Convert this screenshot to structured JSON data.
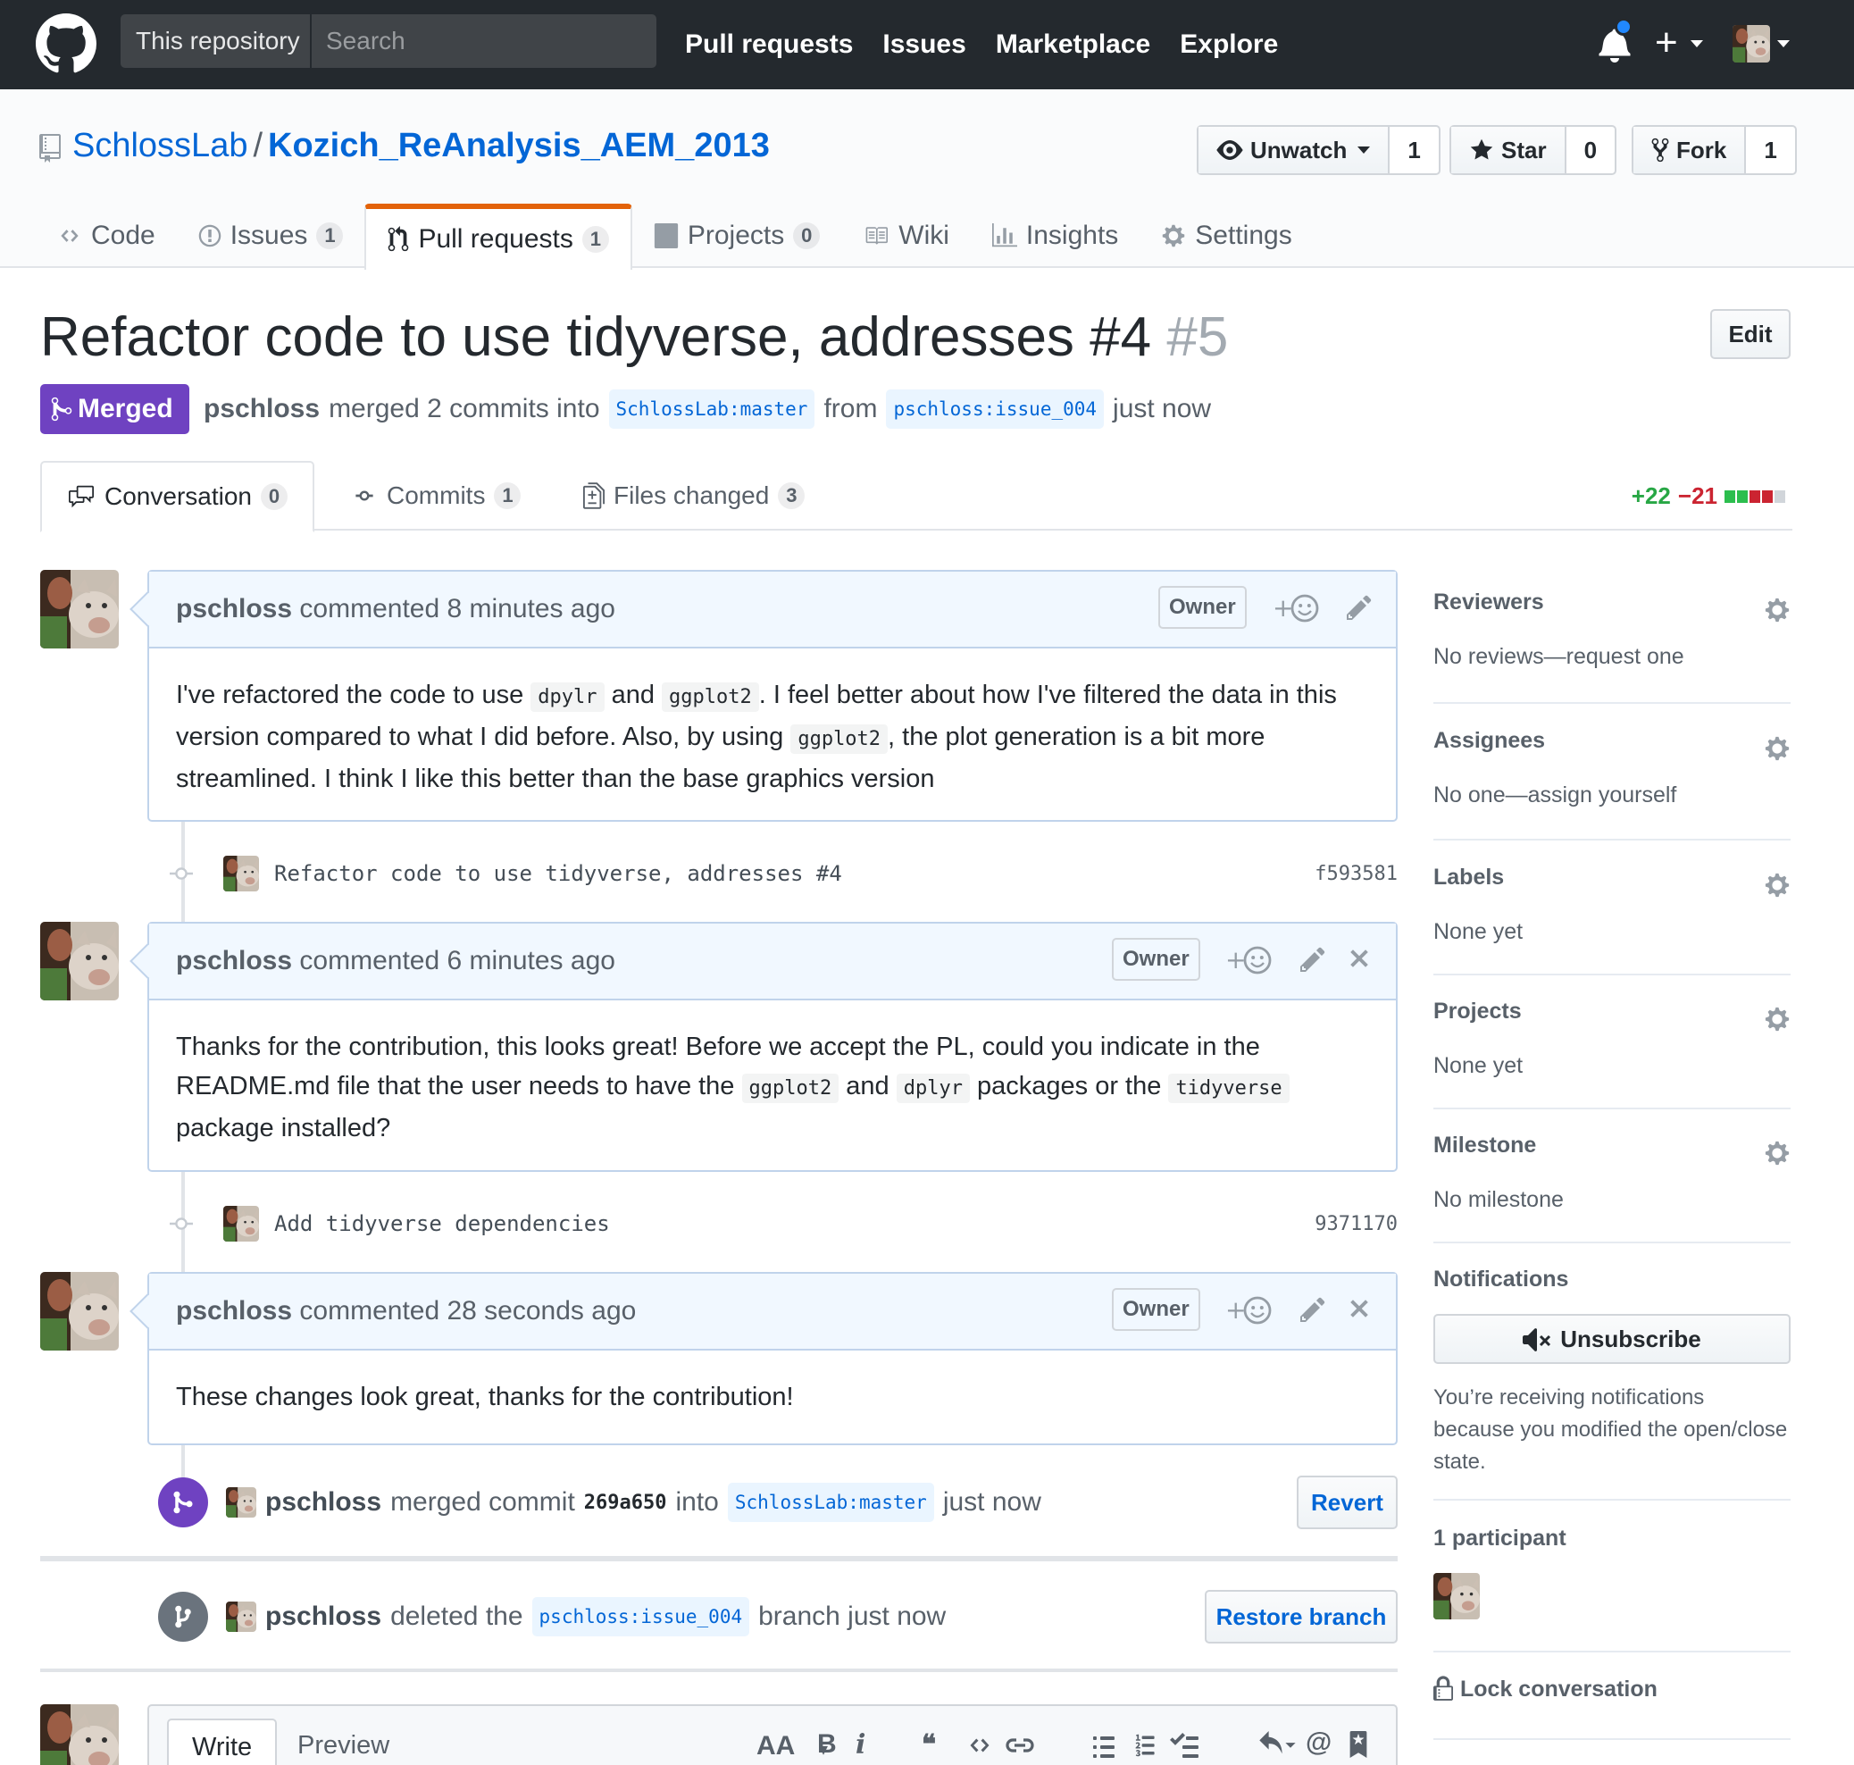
{
  "topnav": {
    "search_scope": "This repository",
    "search_placeholder": "Search",
    "links": [
      "Pull requests",
      "Issues",
      "Marketplace",
      "Explore"
    ],
    "plus": "+"
  },
  "repo": {
    "owner": "SchlossLab",
    "separator": "/",
    "name": "Kozich_ReAnalysis_AEM_2013",
    "watch": {
      "label": "Unwatch",
      "count": "1"
    },
    "star": {
      "label": "Star",
      "count": "0"
    },
    "fork": {
      "label": "Fork",
      "count": "1"
    },
    "tabs": [
      {
        "label": "Code",
        "count": ""
      },
      {
        "label": "Issues",
        "count": "1"
      },
      {
        "label": "Pull requests",
        "count": "1"
      },
      {
        "label": "Projects",
        "count": "0"
      },
      {
        "label": "Wiki",
        "count": ""
      },
      {
        "label": "Insights",
        "count": ""
      },
      {
        "label": "Settings",
        "count": ""
      }
    ],
    "accent_color": "#e36209"
  },
  "pr": {
    "title": "Refactor code to use tidyverse, addresses #4",
    "number": "#5",
    "edit_label": "Edit",
    "state": "Merged",
    "state_color": "#6f42c1",
    "author": "pschloss",
    "merged_text": "merged 2 commits into",
    "base_branch": "SchlossLab:master",
    "from_text": "from",
    "head_branch": "pschloss:issue_004",
    "time": "just now",
    "tabs": [
      {
        "label": "Conversation",
        "count": "0"
      },
      {
        "label": "Commits",
        "count": "1"
      },
      {
        "label": "Files changed",
        "count": "3"
      }
    ],
    "additions": "+22",
    "deletions": "−21"
  },
  "timeline": {
    "comments": [
      {
        "author": "pschloss",
        "meta": "commented 8 minutes ago",
        "role": "Owner",
        "body": [
          "I've refactored the code to use ",
          "dpylr",
          " and ",
          "ggplot2",
          ". I feel better about how I've filtered the data in this version compared to what I did before. Also, by using ",
          "ggplot2",
          ", the plot generation is a bit more streamlined. I think I like this better than the base graphics version"
        ]
      },
      {
        "author": "pschloss",
        "meta": "commented 6 minutes ago",
        "role": "Owner",
        "body": [
          "Thanks for the contribution, this looks great! Before we accept the PL, could you indicate in the README.md file that the user needs to have the ",
          "ggplot2",
          " and ",
          "dplyr",
          " packages or the ",
          "tidyverse",
          " package installed?"
        ]
      },
      {
        "author": "pschloss",
        "meta": "commented 28 seconds ago",
        "role": "Owner",
        "body": [
          "These changes look great, thanks for the contribution!"
        ]
      }
    ],
    "commits": [
      {
        "message": "Refactor code to use tidyverse, addresses #4",
        "sha": "f593581"
      },
      {
        "message": "Add tidyverse dependencies",
        "sha": "9371170"
      }
    ],
    "merge_event": {
      "author": "pschloss",
      "text": "merged commit",
      "sha": "269a650",
      "into": "into",
      "branch": "SchlossLab:master",
      "time": "just now",
      "button": "Revert"
    },
    "delete_event": {
      "author": "pschloss",
      "text": "deleted the",
      "branch": "pschloss:issue_004",
      "time": "branch just now",
      "button": "Restore branch"
    }
  },
  "sidebar": {
    "reviewers": {
      "heading": "Reviewers",
      "value": "No reviews—request one"
    },
    "assignees": {
      "heading": "Assignees",
      "value": "No one—assign yourself"
    },
    "labels": {
      "heading": "Labels",
      "value": "None yet"
    },
    "projects": {
      "heading": "Projects",
      "value": "None yet"
    },
    "milestone": {
      "heading": "Milestone",
      "value": "No milestone"
    },
    "notifications": {
      "heading": "Notifications",
      "button": "Unsubscribe",
      "reason": "You’re receiving notifications because you modified the open/close state."
    },
    "participants": {
      "heading": "1 participant"
    },
    "lock": "Lock conversation"
  },
  "composer": {
    "tabs": [
      "Write",
      "Preview"
    ],
    "tools": {
      "text_size": "AA",
      "bold": "B",
      "italic": "i",
      "mention": "@"
    }
  }
}
